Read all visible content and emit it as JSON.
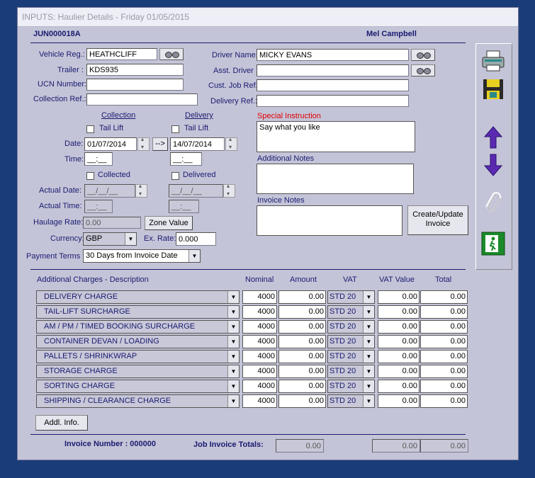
{
  "window": {
    "title": "INPUTS: Haulier Details - Friday 01/05/2015"
  },
  "header": {
    "job_ref": "JUN000018A",
    "user": "Mel Campbell"
  },
  "vehicle": {
    "reg_label": "Vehicle Reg.:",
    "reg": "HEATHCLIFF",
    "trailer_label": "Trailer :",
    "trailer": "KDS935",
    "ucn_label": "UCN Number:",
    "ucn": "",
    "collection_ref_label": "Collection Ref.:",
    "collection_ref": ""
  },
  "driver": {
    "name_label": "Driver Name:",
    "name": "MICKY EVANS",
    "asst_label": "Asst. Driver :",
    "asst": "",
    "cust_job_ref_label": "Cust. Job Ref:",
    "cust_job_ref": "",
    "delivery_ref_label": "Delivery Ref.:",
    "delivery_ref": ""
  },
  "schedule": {
    "collection_header": "Collection",
    "delivery_header": "Delivery",
    "tail_lift_label": "Tail Lift",
    "date_label": "Date:",
    "collection_date": "01/07/2014",
    "delivery_date": "14/07/2014",
    "copy_arrow": "-->",
    "time_label": "Time:",
    "collection_time": "__:__",
    "delivery_time": "__:__",
    "collected_label": "Collected",
    "delivered_label": "Delivered",
    "actual_date_label": "Actual Date:",
    "actual_date_collection": "__/__/__",
    "actual_date_delivery": "__/__/__",
    "actual_time_label": "Actual Time:",
    "actual_time_collection": "__:__",
    "actual_time_delivery": "__:__"
  },
  "rates": {
    "haulage_rate_label": "Haulage Rate:",
    "haulage_rate": "0.00",
    "zone_value_button": "Zone Value",
    "currency_label": "Currency:",
    "currency": "GBP",
    "ex_rate_label": "Ex. Rate:",
    "ex_rate": "0.000",
    "payment_terms_label": "Payment Terms :",
    "payment_terms": "30 Days from Invoice Date"
  },
  "notes": {
    "special_label": "Special Instruction",
    "special": "Say what you like",
    "additional_label": "Additional Notes",
    "additional": "",
    "invoice_label": "Invoice Notes",
    "invoice": "",
    "create_invoice_button": "Create/Update Invoice"
  },
  "charges": {
    "headers": {
      "desc": "Additional Charges - Description",
      "nominal": "Nominal",
      "amount": "Amount",
      "vat": "VAT",
      "vat_value": "VAT Value",
      "total": "Total"
    },
    "rows": [
      {
        "desc": "DELIVERY CHARGE",
        "nominal": "4000",
        "amount": "0.00",
        "vat": "STD 20",
        "vat_value": "0.00",
        "total": "0.00"
      },
      {
        "desc": "TAIL-LIFT SURCHARGE",
        "nominal": "4000",
        "amount": "0.00",
        "vat": "STD 20",
        "vat_value": "0.00",
        "total": "0.00"
      },
      {
        "desc": "AM / PM / TIMED BOOKING SURCHARGE",
        "nominal": "4000",
        "amount": "0.00",
        "vat": "STD 20",
        "vat_value": "0.00",
        "total": "0.00"
      },
      {
        "desc": "CONTAINER DEVAN / LOADING",
        "nominal": "4000",
        "amount": "0.00",
        "vat": "STD 20",
        "vat_value": "0.00",
        "total": "0.00"
      },
      {
        "desc": "PALLETS / SHRINKWRAP",
        "nominal": "4000",
        "amount": "0.00",
        "vat": "STD 20",
        "vat_value": "0.00",
        "total": "0.00"
      },
      {
        "desc": "STORAGE CHARGE",
        "nominal": "4000",
        "amount": "0.00",
        "vat": "STD 20",
        "vat_value": "0.00",
        "total": "0.00"
      },
      {
        "desc": "SORTING CHARGE",
        "nominal": "4000",
        "amount": "0.00",
        "vat": "STD 20",
        "vat_value": "0.00",
        "total": "0.00"
      },
      {
        "desc": "SHIPPING / CLEARANCE CHARGE",
        "nominal": "4000",
        "amount": "0.00",
        "vat": "STD 20",
        "vat_value": "0.00",
        "total": "0.00"
      }
    ],
    "addl_info_button": "Addl. Info."
  },
  "footer": {
    "invoice_number_label": "Invoice Number : 000000",
    "totals_label": "Job Invoice Totals:",
    "amount_total": "0.00",
    "vat_total": "0.00",
    "grand_total": "0.00"
  },
  "toolbar_icons": [
    "printer-icon",
    "save-disk-icon",
    "arrow-up-icon",
    "arrow-down-icon",
    "paperclip-icon",
    "exit-icon"
  ],
  "colors": {
    "label": "#1a1a70",
    "special_label": "#e00000",
    "arrow": "#5a2ab0",
    "exit": "#1a8a2a"
  }
}
